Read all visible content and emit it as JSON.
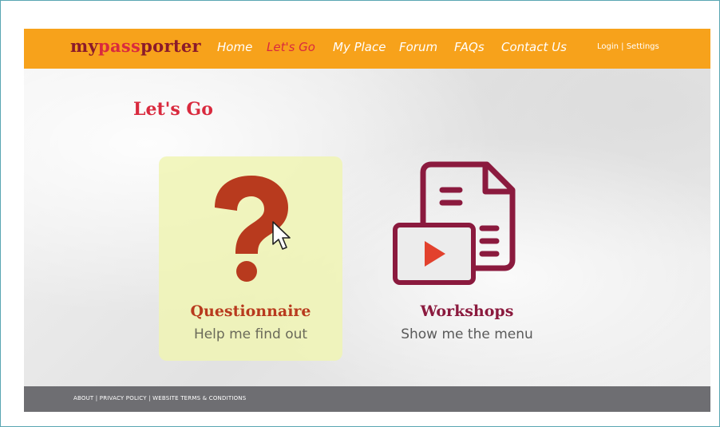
{
  "brand": {
    "part1": "my",
    "part2": "pass",
    "part3": "porter"
  },
  "nav": {
    "items": [
      {
        "label": "Home",
        "active": false
      },
      {
        "label": "Let's Go",
        "active": true
      },
      {
        "label": "My Place",
        "active": false
      },
      {
        "label": "Forum",
        "active": false
      },
      {
        "label": "FAQs",
        "active": false
      },
      {
        "label": "Contact Us",
        "active": false
      }
    ],
    "auth": "Login | Settings"
  },
  "page": {
    "title": "Let's Go"
  },
  "cards": [
    {
      "title": "Questionnaire",
      "subtitle": "Help me find out",
      "icon": "question-mark-icon"
    },
    {
      "title": "Workshops",
      "subtitle": "Show me the menu",
      "icon": "document-video-icon"
    }
  ],
  "footer": {
    "links": "ABOUT | PRIVACY POLICY | WEBSITE TERMS & CONDITIONS"
  },
  "colors": {
    "nav_bg": "#f7a21b",
    "accent_red": "#d92a3e",
    "brand_dark": "#8b1a2b",
    "questionnaire": "#b83a1e",
    "workshops": "#8b1a3e",
    "footer_bg": "#6e6e72"
  }
}
